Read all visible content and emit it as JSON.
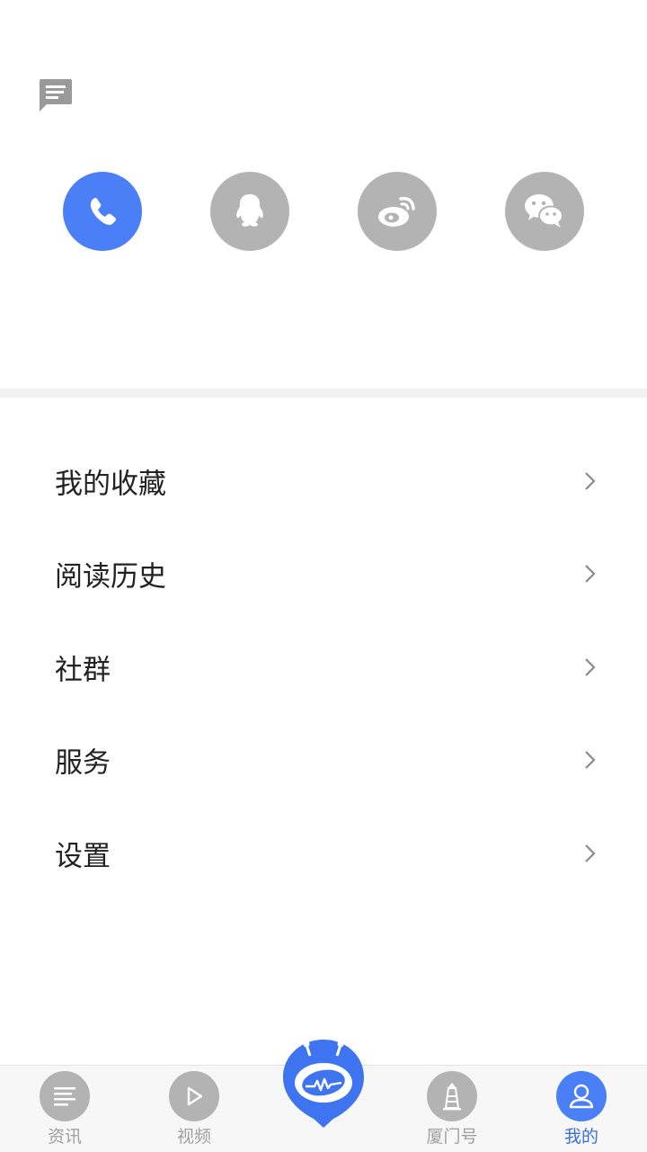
{
  "header": {
    "message_icon": "message-icon"
  },
  "login_methods": [
    {
      "name": "phone",
      "icon": "phone-icon",
      "color": "#4a7ff7"
    },
    {
      "name": "qq",
      "icon": "qq-icon",
      "color": "#b3b3b3"
    },
    {
      "name": "weibo",
      "icon": "weibo-icon",
      "color": "#b3b3b3"
    },
    {
      "name": "wechat",
      "icon": "wechat-icon",
      "color": "#b3b3b3"
    }
  ],
  "menu": {
    "items": [
      {
        "label": "我的收藏"
      },
      {
        "label": "阅读历史"
      },
      {
        "label": "社群"
      },
      {
        "label": "服务"
      },
      {
        "label": "设置"
      }
    ]
  },
  "tabbar": {
    "tabs": [
      {
        "label": "资讯",
        "icon": "news-icon"
      },
      {
        "label": "视频",
        "icon": "video-icon"
      },
      {
        "label": "",
        "icon": "robot-icon"
      },
      {
        "label": "厦门号",
        "icon": "lighthouse-icon"
      },
      {
        "label": "我的",
        "icon": "user-icon",
        "active": true
      }
    ]
  },
  "colors": {
    "accent": "#4a7ff7",
    "inactive": "#b3b3b3"
  }
}
